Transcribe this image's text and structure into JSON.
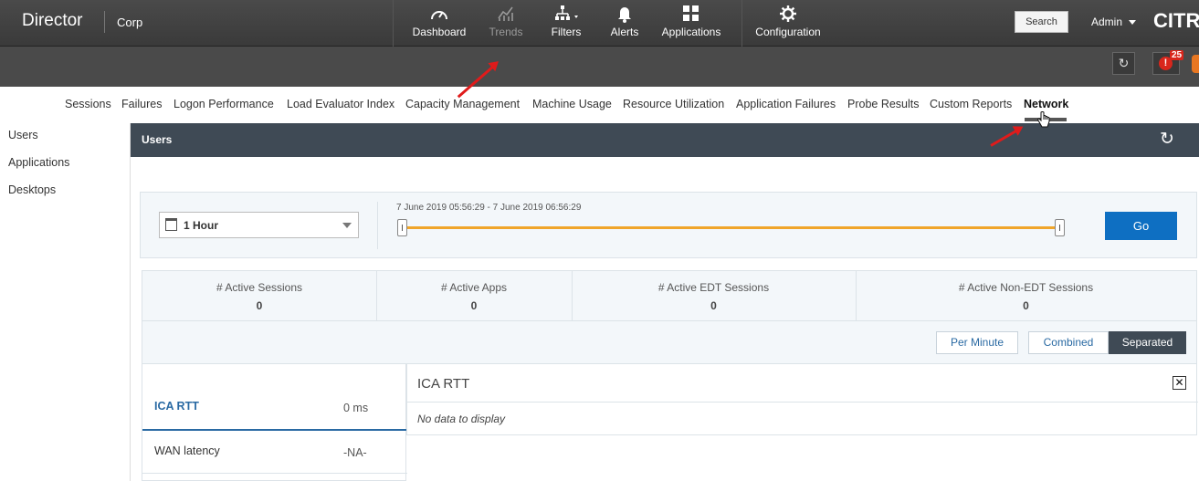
{
  "header": {
    "brand": "Director",
    "site": "Corp",
    "nav": [
      {
        "label": "Dashboard",
        "icon": "dashboard-gauge-icon"
      },
      {
        "label": "Trends",
        "icon": "trends-chart-icon"
      },
      {
        "label": "Filters",
        "icon": "filters-tree-icon"
      },
      {
        "label": "Alerts",
        "icon": "bell-icon"
      },
      {
        "label": "Applications",
        "icon": "grid-icon"
      },
      {
        "label": "Configuration",
        "icon": "gear-icon"
      }
    ],
    "search_label": "Search",
    "user_label": "Admin",
    "logo_text": "CITRIX",
    "alert_count": "25"
  },
  "tabs": [
    "Sessions",
    "Failures",
    "Logon Performance",
    "Load Evaluator Index",
    "Capacity Management",
    "Machine Usage",
    "Resource Utilization",
    "Application Failures",
    "Probe Results",
    "Custom Reports",
    "Network"
  ],
  "active_tab": "Network",
  "sidebar": [
    "Users",
    "Applications",
    "Desktops"
  ],
  "panel": {
    "title": "Users"
  },
  "filter": {
    "period": "1 Hour",
    "range": "7 June 2019 05:56:29 - 7 June 2019 06:56:29",
    "go_label": "Go"
  },
  "stats": [
    {
      "title": "# Active Sessions",
      "value": "0"
    },
    {
      "title": "# Active Apps",
      "value": "0"
    },
    {
      "title": "# Active EDT Sessions",
      "value": "0"
    },
    {
      "title": "# Active Non-EDT Sessions",
      "value": "0"
    }
  ],
  "modes": {
    "per_minute": "Per Minute",
    "combined": "Combined",
    "separated": "Separated",
    "selected": "Separated"
  },
  "metrics": [
    {
      "name": "ICA RTT",
      "value": "0 ms",
      "selected": true
    },
    {
      "name": "WAN latency",
      "value": "-NA-",
      "selected": false
    }
  ],
  "detail": {
    "title": "ICA RTT",
    "empty_text": "No data to display"
  },
  "colors": {
    "topbar": "#3a3a3a",
    "panel_header": "#3f4a55",
    "accent_blue": "#0e6fc2",
    "slider": "#f0a52a",
    "alert_red": "#d9261c",
    "annotation_arrow": "#e01b1b"
  }
}
